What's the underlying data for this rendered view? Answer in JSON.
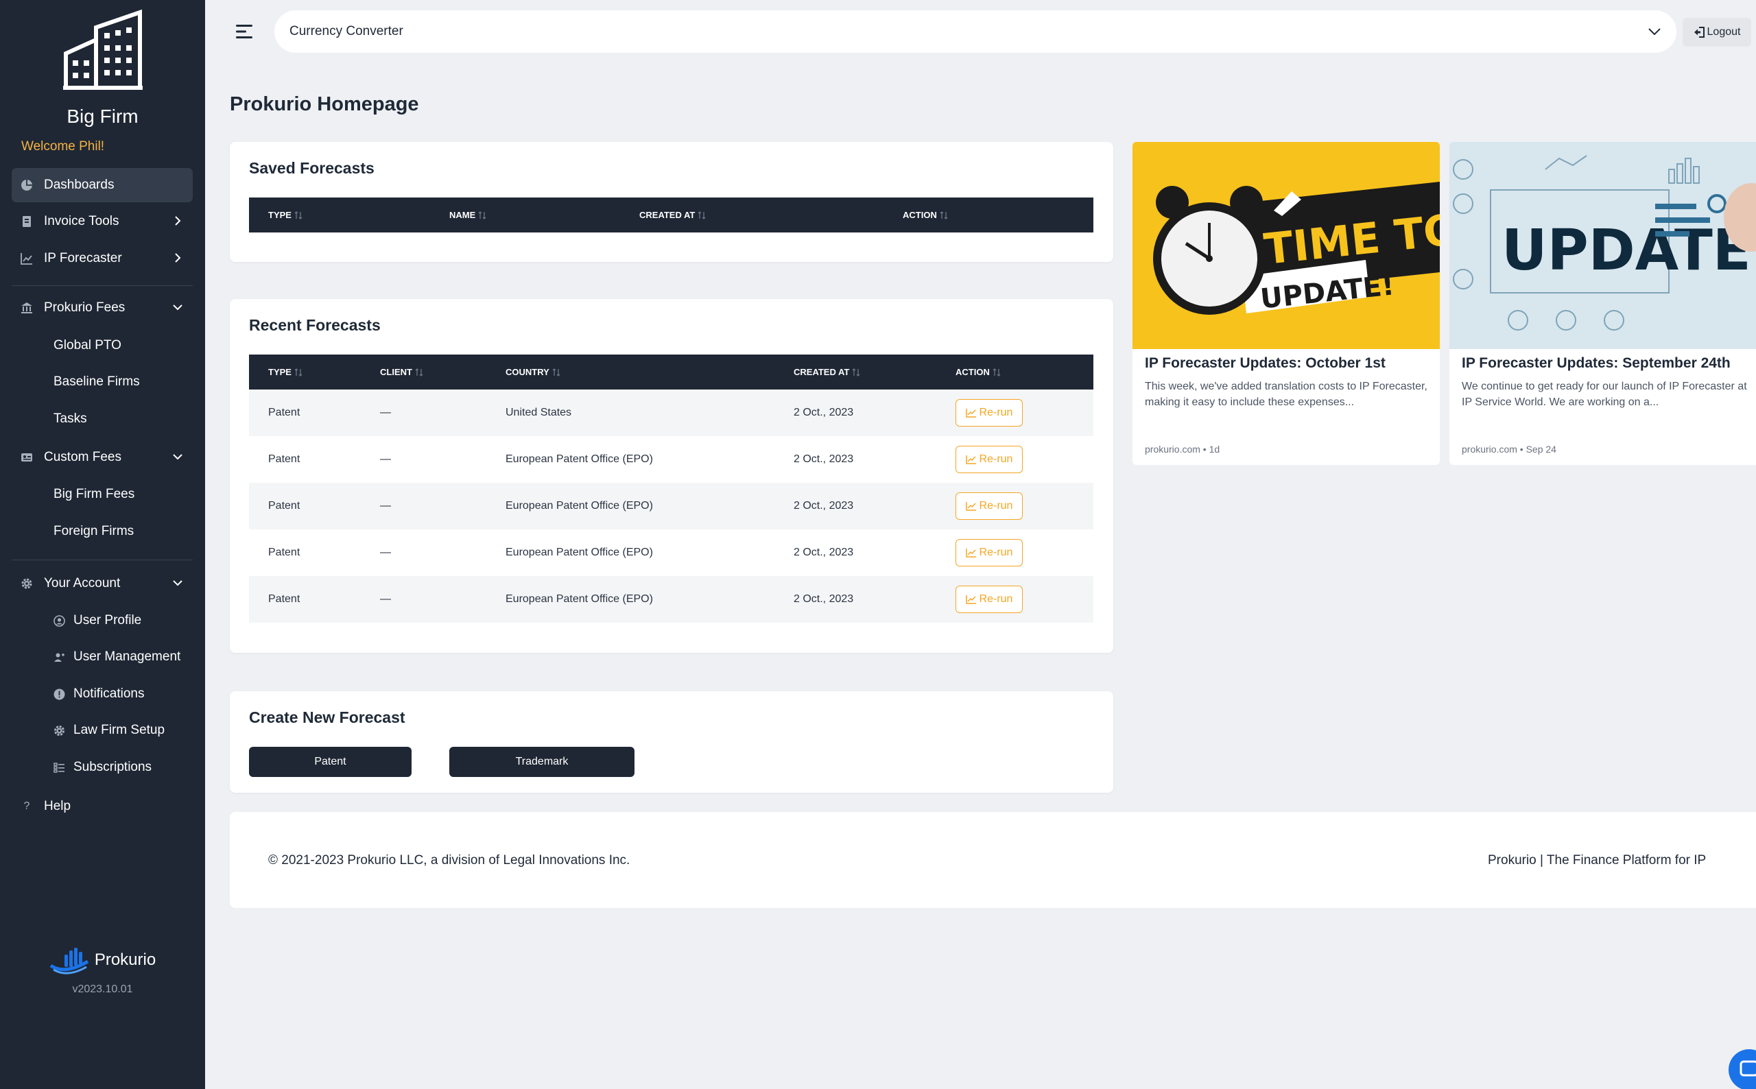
{
  "sidebar": {
    "firm_name": "Big Firm",
    "welcome": "Welcome Phil!",
    "items": {
      "dashboards": "Dashboards",
      "invoice_tools": "Invoice Tools",
      "ip_forecaster": "IP Forecaster",
      "prokurio_fees": "Prokurio Fees",
      "global_pto": "Global PTO",
      "baseline_firms": "Baseline Firms",
      "tasks": "Tasks",
      "custom_fees": "Custom Fees",
      "big_firm_fees": "Big Firm Fees",
      "foreign_firms": "Foreign Firms",
      "your_account": "Your Account",
      "user_profile": "User Profile",
      "user_management": "User Management",
      "notifications": "Notifications",
      "law_firm_setup": "Law Firm Setup",
      "subscriptions": "Subscriptions",
      "help": "Help"
    },
    "brand_name": "Prokurio",
    "version": "v2023.10.01"
  },
  "topbar": {
    "selector_value": "Currency Converter",
    "logout_label": "Logout"
  },
  "page_title": "Prokurio Homepage",
  "saved_forecasts": {
    "title": "Saved Forecasts",
    "columns": [
      "TYPE",
      "NAME",
      "CREATED AT",
      "ACTION"
    ]
  },
  "recent_forecasts": {
    "title": "Recent Forecasts",
    "columns": [
      "TYPE",
      "CLIENT",
      "COUNTRY",
      "CREATED AT",
      "ACTION"
    ],
    "rows": [
      {
        "type": "Patent",
        "client": "—",
        "country": "United States",
        "created": "2 Oct., 2023",
        "action": "Re-run"
      },
      {
        "type": "Patent",
        "client": "—",
        "country": "European Patent Office (EPO)",
        "created": "2 Oct., 2023",
        "action": "Re-run"
      },
      {
        "type": "Patent",
        "client": "—",
        "country": "European Patent Office (EPO)",
        "created": "2 Oct., 2023",
        "action": "Re-run"
      },
      {
        "type": "Patent",
        "client": "—",
        "country": "European Patent Office (EPO)",
        "created": "2 Oct., 2023",
        "action": "Re-run"
      },
      {
        "type": "Patent",
        "client": "—",
        "country": "European Patent Office (EPO)",
        "created": "2 Oct., 2023",
        "action": "Re-run"
      }
    ]
  },
  "create_forecast": {
    "title": "Create New Forecast",
    "patent_label": "Patent",
    "trademark_label": "Trademark"
  },
  "news": [
    {
      "image_text_1": "TIME TO",
      "image_text_2": "UPDATE!",
      "title": "IP Forecaster Updates: October 1st",
      "excerpt": "This week, we've added translation costs to IP Forecaster, making it easy to include these expenses...",
      "meta": "prokurio.com • 1d"
    },
    {
      "image_text_1": "UPDATE",
      "title": "IP Forecaster Updates: September 24th",
      "excerpt": "We continue to get ready for our launch of IP Forecaster at IP Service World. We are working on a...",
      "meta": "prokurio.com • Sep 24"
    }
  ],
  "footer": {
    "copyright": "© 2021-2023 Prokurio LLC, a division of Legal Innovations Inc.",
    "tagline": "Prokurio | The Finance Platform for IP"
  },
  "colors": {
    "sidebar_bg": "#1f2734",
    "accent_orange": "#f5a623",
    "welcome_gold": "#f5b342",
    "page_bg": "#eef0f3",
    "brand_blue": "#1a73e8"
  },
  "icons": [
    "building-icon",
    "pie-chart-icon",
    "invoice-icon",
    "trend-chart-icon",
    "bank-icon",
    "id-card-icon",
    "gear-icon",
    "user-circle-icon",
    "user-plus-icon",
    "alert-icon",
    "list-icon",
    "question-icon",
    "hamburger-icon",
    "chevron-down-icon",
    "chevron-right-icon",
    "logout-icon",
    "sort-icon",
    "chat-icon"
  ]
}
